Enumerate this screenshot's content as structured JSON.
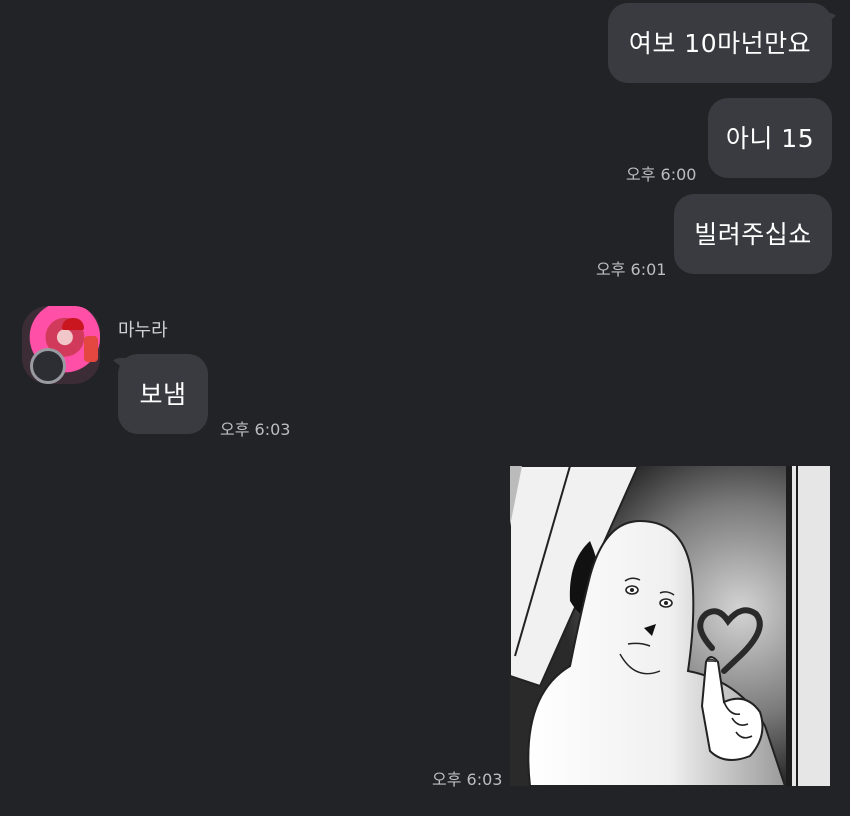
{
  "messages": {
    "m1": {
      "text": "여보 10마넌만요"
    },
    "m2": {
      "text": "아니 15",
      "time": "오후 6:00"
    },
    "m3": {
      "text": "빌려주십쇼",
      "time": "오후 6:01"
    },
    "m4": {
      "sender": "마누라",
      "text": "보냄",
      "time": "오후 6:03"
    },
    "m5": {
      "time": "오후 6:03"
    }
  },
  "icons": {
    "avatar": "profile-avatar",
    "photo": "cartoon-image"
  },
  "colors": {
    "background": "#222327",
    "bubble": "#3a3b40",
    "timestamp": "#bcbdc1"
  }
}
